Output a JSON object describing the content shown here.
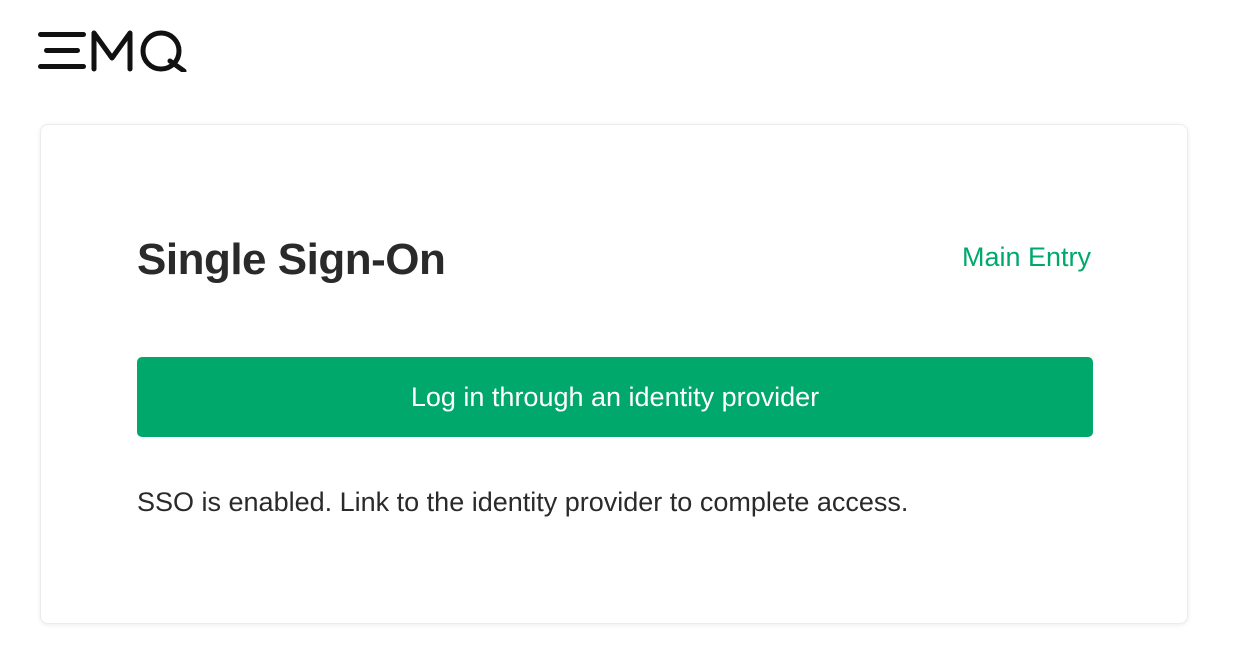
{
  "brand": {
    "logo_text": "EMQ",
    "logo_color": "#111111"
  },
  "card": {
    "title": "Single Sign-On",
    "main_entry_link": "Main Entry",
    "sso_button_label": "Log in through an identity provider",
    "info_text": "SSO is enabled. Link to the identity provider to complete access."
  },
  "colors": {
    "accent": "#00a86b",
    "text": "#2a2a2a",
    "background": "#ffffff"
  }
}
